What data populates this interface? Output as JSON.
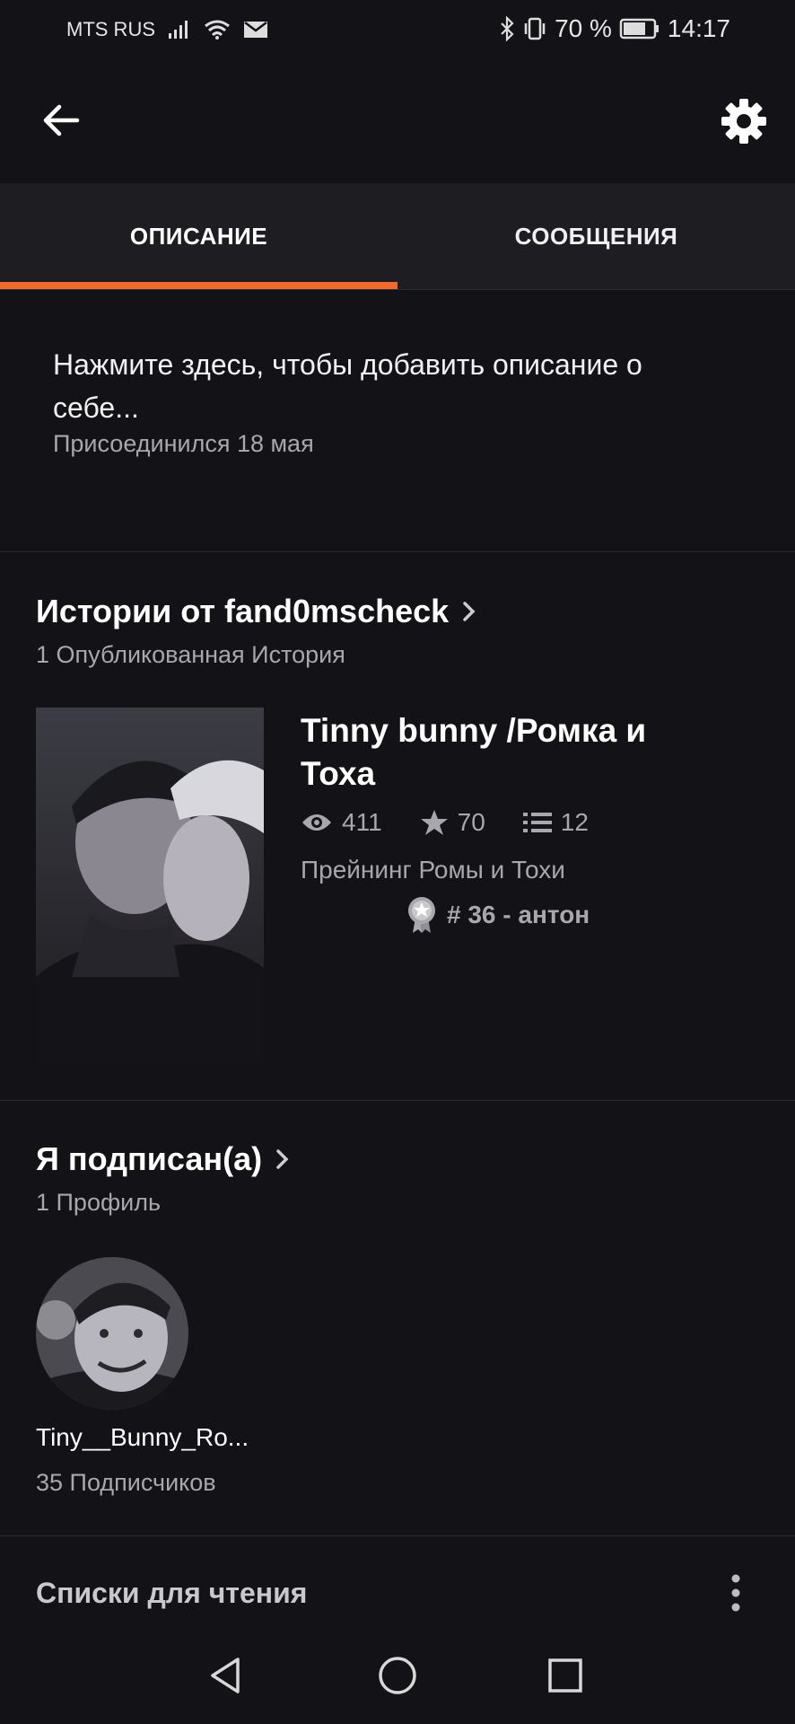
{
  "status_bar": {
    "carrier": "MTS RUS",
    "battery": "70 %",
    "time": "14:17"
  },
  "tabs": [
    {
      "label": "ОПИСАНИЕ",
      "active": true
    },
    {
      "label": "СООБЩЕНИЯ",
      "active": false
    }
  ],
  "about": {
    "description_prompt": "Нажмите здесь, чтобы добавить описание о себе...",
    "joined": "Присоединился 18 мая"
  },
  "stories": {
    "title": "Истории от fand0mscheck",
    "count_label": "1 Опубликованная История",
    "items": [
      {
        "title": "Tinny bunny /Ромка и Тоха",
        "reads": "411",
        "votes": "70",
        "parts": "12",
        "description": "Прейнинг Ромы и Тохи",
        "rank": "# 36 - антон"
      }
    ]
  },
  "following": {
    "title": "Я подписан(а)",
    "count_label": "1 Профиль",
    "profiles": [
      {
        "name": "Tiny__Bunny_Ro...",
        "followers": "35 Подписчиков"
      }
    ]
  },
  "reading_lists": {
    "title": "Списки для чтения"
  },
  "colors": {
    "background": "#131216",
    "tab_bar": "#1e1d22",
    "accent": "#f06a2e",
    "muted_text": "#a8a7ad"
  },
  "icons": [
    "back-arrow-icon",
    "gear-icon",
    "eye-icon",
    "star-icon",
    "list-icon",
    "medal-icon",
    "chevron-right-icon",
    "more-vertical-icon",
    "nav-back-icon",
    "nav-home-icon",
    "nav-recents-icon"
  ]
}
